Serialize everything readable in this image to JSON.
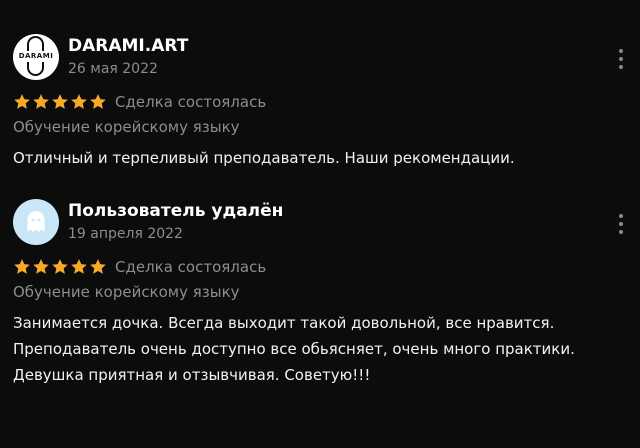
{
  "reviews": [
    {
      "author": "DARAMI.ART",
      "avatar_text": "DARAMI",
      "date": "26 мая 2022",
      "rating": 5,
      "status": "Сделка состоялась",
      "subject": "Обучение корейскому языку",
      "text_lines": [
        "Отличный и терпеливый преподаватель. Наши рекомендации."
      ]
    },
    {
      "author": "Пользователь удалён",
      "date": "19 апреля 2022",
      "rating": 5,
      "status": "Сделка состоялась",
      "subject": "Обучение корейскому языку",
      "text_lines": [
        "Занимается дочка. Всегда выходит такой довольной, все нравится.",
        "Преподаватель очень доступно все обьясняет, очень много практики.",
        "Девушка приятная и отзывчивая. Советую!!!"
      ]
    }
  ],
  "colors": {
    "background": "#0c0c0c",
    "star": "#f7a928",
    "muted_text": "#8d8d8d",
    "ghost_avatar_bg": "#c9e7f8"
  },
  "icons": {
    "more": "more-vertical-icon",
    "star": "star-icon",
    "ghost": "ghost-icon"
  }
}
